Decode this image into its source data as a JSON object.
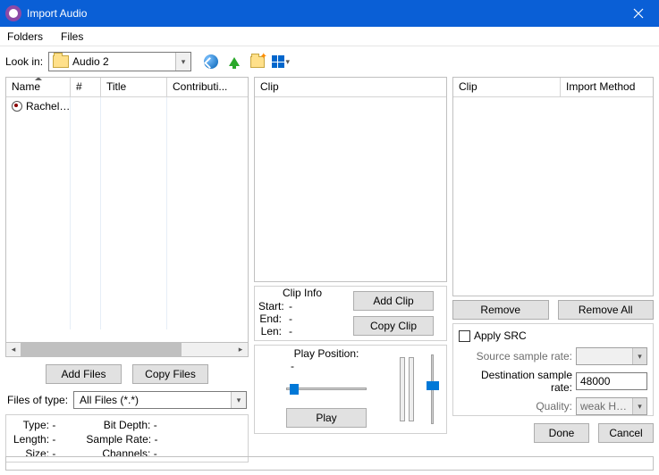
{
  "window": {
    "title": "Import Audio"
  },
  "menubar": {
    "folders": "Folders",
    "files": "Files"
  },
  "lookin": {
    "label": "Look in:",
    "folder": "Audio 2"
  },
  "file_table": {
    "columns": {
      "name": "Name",
      "num": "#",
      "title": "Title",
      "contrib": "Contributi..."
    },
    "rows": [
      {
        "name": "Rachel ..."
      }
    ]
  },
  "left_buttons": {
    "add": "Add Files",
    "copy": "Copy Files"
  },
  "filetype": {
    "label": "Files of type:",
    "value": "All Files (*.*)"
  },
  "props": {
    "type_k": "Type:",
    "type_v": "-",
    "length_k": "Length:",
    "length_v": "-",
    "size_k": "Size:",
    "size_v": "-",
    "bitdepth_k": "Bit Depth:",
    "bitdepth_v": "-",
    "srate_k": "Sample Rate:",
    "srate_v": "-",
    "channels_k": "Channels:",
    "channels_v": "-"
  },
  "mid": {
    "clip_header": "Clip",
    "clip_info_title": "Clip Info",
    "start_k": "Start:",
    "start_v": "-",
    "end_k": "End:",
    "end_v": "-",
    "len_k": "Len:",
    "len_v": "-",
    "add_clip": "Add Clip",
    "copy_clip": "Copy Clip",
    "play_pos": "Play Position:",
    "play_val": "-",
    "play": "Play"
  },
  "right": {
    "col1": "Clip",
    "col2": "Import Method",
    "remove": "Remove",
    "remove_all": "Remove All",
    "apply_src": "Apply SRC",
    "src_rate_lbl": "Source sample rate:",
    "dst_rate_lbl": "Destination sample rate:",
    "dst_rate_val": "48000",
    "quality_lbl": "Quality:",
    "quality_val": "weak Head (Slowest",
    "done": "Done",
    "cancel": "Cancel"
  }
}
